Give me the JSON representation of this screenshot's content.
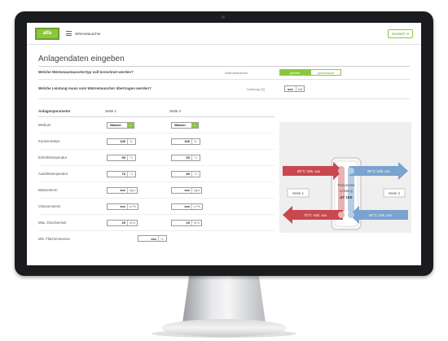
{
  "app": {
    "logo_text": "alfa",
    "title": "Wärmetauscher",
    "language": "Deutsch"
  },
  "page": {
    "title": "Anlagendaten eingeben"
  },
  "q1": {
    "text": "Welche Wärmeaustauschertyp soll berechnet werden?",
    "label": "Wärmetauscher",
    "opt_active": "gelötet",
    "opt_inactive": "geschraubt"
  },
  "q2": {
    "text": "Welche Leistung muss vom Wärmetauscher übertragen werden?",
    "label": "Leistung (Q)",
    "value": "xxx",
    "unit": "kW"
  },
  "params": {
    "headers": [
      "Anlagenparameter",
      "Seite 1",
      "Seite 2"
    ],
    "rows": [
      {
        "label": "Medium",
        "s1": "Wasser",
        "s2": "Wasser",
        "unit": "",
        "kind": "select"
      },
      {
        "label": "Konzentration",
        "s1": "100",
        "s2": "100",
        "unit": "%"
      },
      {
        "label": "Eintrittstemperatur",
        "s1": "90",
        "s2": "60",
        "unit": "°C"
      },
      {
        "label": "Austrittstemperatur",
        "s1": "70",
        "s2": "80",
        "unit": "°C"
      },
      {
        "label": "Massestrom",
        "s1": "xxx",
        "s2": "xxx",
        "unit": "kg/s"
      },
      {
        "label": "Volumenstrom",
        "s1": "xxx",
        "s2": "xxx",
        "unit": "m³/h"
      },
      {
        "label": "Max. Druckverlust",
        "s1": "25",
        "s2": "20",
        "unit": "kPa"
      }
    ],
    "last": {
      "label": "Min. Flächenreserve",
      "value": "xxx",
      "unit": "%"
    }
  },
  "diagram": {
    "hot_in": "90°C Volt. xxx",
    "hot_out": "70°C Volt. xxx",
    "cold_in": "60°C Volt. xxx",
    "cold_out": "80°C Volt. xxx",
    "side1": "Seite 1",
    "side2": "Seite 2",
    "center_l1": "Temperatur",
    "center_l2": "Leistung",
    "center_l3": "ΔT 10K",
    "colors": {
      "hot": "#c9484f",
      "cold": "#7aa3cf",
      "panel": "#efefef"
    }
  }
}
